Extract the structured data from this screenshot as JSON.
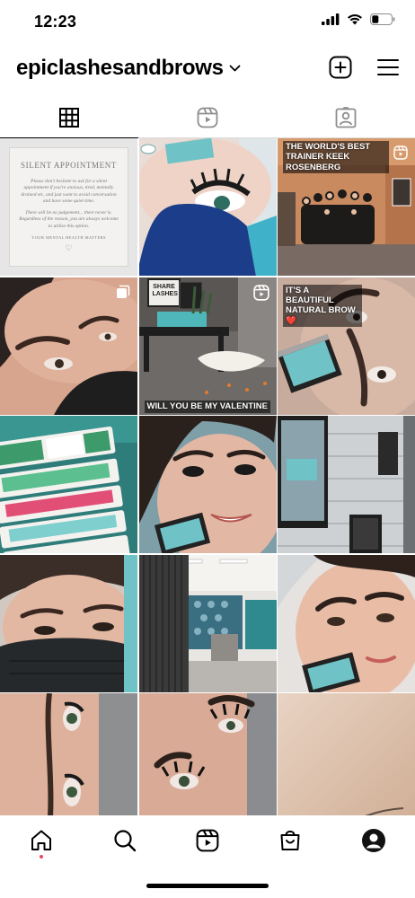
{
  "status_bar": {
    "time": "12:23",
    "icons": [
      "cellular-signal-icon",
      "wifi-icon",
      "battery-icon"
    ]
  },
  "header": {
    "username": "epiclashesandbrows",
    "icons": [
      "chevron-down-icon",
      "create-post-icon",
      "menu-icon"
    ]
  },
  "tabs": [
    {
      "name": "grid",
      "icon": "grid-icon",
      "active": true
    },
    {
      "name": "reels",
      "icon": "reels-icon",
      "active": false
    },
    {
      "name": "tagged",
      "icon": "tagged-icon",
      "active": false
    }
  ],
  "posts": [
    {
      "id": "silent",
      "title": "SILENT APPOINTMENT",
      "body": "Please don't hesitate to ask for a silent appointment if you're anxious, tired, mentally drained etc, and just want to avoid conversation and have some quiet time.",
      "body2": "There will be no judgement... there never is. Regardless of the reason, you are always welcome to utilize this option.",
      "footer": "YOUR MENTAL HEALTH MATTERS"
    },
    {
      "id": "p2"
    },
    {
      "id": "p3",
      "caption": "THE WORLD'S BEST TRAINER KEEK ROSENBERG"
    },
    {
      "id": "p4"
    },
    {
      "id": "p5",
      "caption": "WILL YOU BE MY VALENTINE",
      "sign": "SHARE LASHES"
    },
    {
      "id": "p6",
      "caption": "IT'S A BEAUTIFUL NATURAL BROW ❤️"
    },
    {
      "id": "p7"
    },
    {
      "id": "p8"
    },
    {
      "id": "p9"
    },
    {
      "id": "p10"
    },
    {
      "id": "p11"
    },
    {
      "id": "p12"
    },
    {
      "id": "p13"
    },
    {
      "id": "p14"
    },
    {
      "id": "p15"
    }
  ],
  "bottom_nav": [
    {
      "name": "home",
      "icon": "home-icon",
      "active": true
    },
    {
      "name": "search",
      "icon": "search-icon"
    },
    {
      "name": "reels",
      "icon": "reels-icon"
    },
    {
      "name": "shop",
      "icon": "shop-icon"
    },
    {
      "name": "profile",
      "icon": "profile-icon"
    }
  ],
  "colors": {
    "notification_dot": "#ed4956",
    "divider": "#dbdbdb",
    "teal_card": "#6fc3c7"
  }
}
